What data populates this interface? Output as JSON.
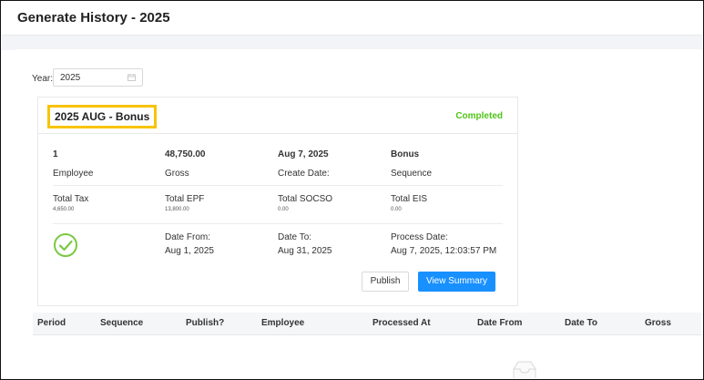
{
  "page": {
    "title": "Generate History - 2025"
  },
  "filter": {
    "year_label": "Year:",
    "year_value": "2025",
    "calendar_icon": "calendar-icon"
  },
  "card": {
    "title": "2025 AUG - Bonus",
    "status": "Completed",
    "status_color": "#52c41a",
    "highlight_color": "#f7c300",
    "row1": [
      {
        "value": "1",
        "label": "Employee"
      },
      {
        "value": "48,750.00",
        "label": "Gross"
      },
      {
        "value": "Aug 7, 2025",
        "label": "Create Date:"
      },
      {
        "value": "Bonus",
        "label": "Sequence"
      }
    ],
    "row2": [
      {
        "label": "Total Tax",
        "value": "4,650.00"
      },
      {
        "label": "Total EPF",
        "value": "13,800.00"
      },
      {
        "label": "Total SOCSO",
        "value": "0.00"
      },
      {
        "label": "Total EIS",
        "value": "0.00"
      }
    ],
    "row3": [
      {
        "label": "Date From:",
        "value": "Aug 1, 2025"
      },
      {
        "label": "Date To:",
        "value": "Aug 31, 2025"
      },
      {
        "label": "Process Date:",
        "value": "Aug 7, 2025, 12:03:57 PM"
      }
    ],
    "status_icon": "check-circle-icon",
    "buttons": {
      "publish": "Publish",
      "view_summary": "View Summary"
    },
    "primary_color": "#1890ff"
  },
  "table": {
    "columns": [
      "Period",
      "Sequence",
      "Publish?",
      "Employee",
      "Processed At",
      "Date From",
      "Date To",
      "Gross"
    ],
    "empty_icon": "empty-inbox-icon"
  }
}
